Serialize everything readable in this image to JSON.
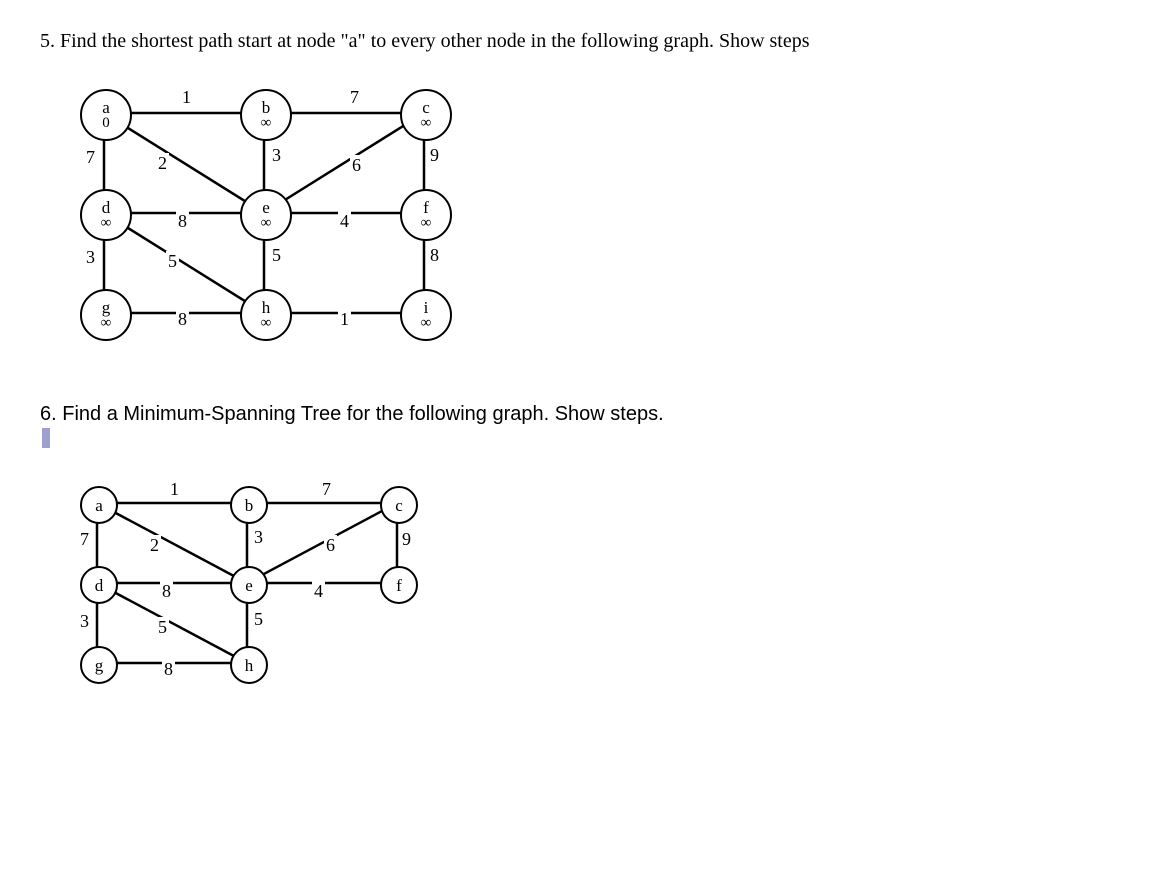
{
  "q5": {
    "text": "5. Find the shortest path start at node \"a\" to every other node in the following graph.  Show steps",
    "nodes": {
      "a": {
        "label": "a",
        "value": "0"
      },
      "b": {
        "label": "b",
        "value": "∞"
      },
      "c": {
        "label": "c",
        "value": "∞"
      },
      "d": {
        "label": "d",
        "value": "∞"
      },
      "e": {
        "label": "e",
        "value": "∞"
      },
      "f": {
        "label": "f",
        "value": "∞"
      },
      "g": {
        "label": "g",
        "value": "∞"
      },
      "h": {
        "label": "h",
        "value": "∞"
      },
      "i": {
        "label": "i",
        "value": "∞"
      }
    },
    "edges": {
      "ab": "1",
      "bc": "7",
      "ad": "7",
      "ae": "2",
      "be": "3",
      "ce": "6",
      "cf": "9",
      "de": "8",
      "ef": "4",
      "dg": "3",
      "dh": "5",
      "eh": "5",
      "fi": "8",
      "gh": "8",
      "hi": "1"
    }
  },
  "q6": {
    "text": "6. Find a Minimum-Spanning Tree for the following graph. Show steps.",
    "nodes": {
      "a": {
        "label": "a"
      },
      "b": {
        "label": "b"
      },
      "c": {
        "label": "c"
      },
      "d": {
        "label": "d"
      },
      "e": {
        "label": "e"
      },
      "f": {
        "label": "f"
      },
      "g": {
        "label": "g"
      },
      "h": {
        "label": "h"
      }
    },
    "edges": {
      "ab": "1",
      "bc": "7",
      "ad": "7",
      "ae": "2",
      "be": "3",
      "ce": "6",
      "cf": "9",
      "de": "8",
      "ef": "4",
      "dg": "3",
      "dh": "5",
      "eh": "5",
      "gh": "8"
    }
  }
}
